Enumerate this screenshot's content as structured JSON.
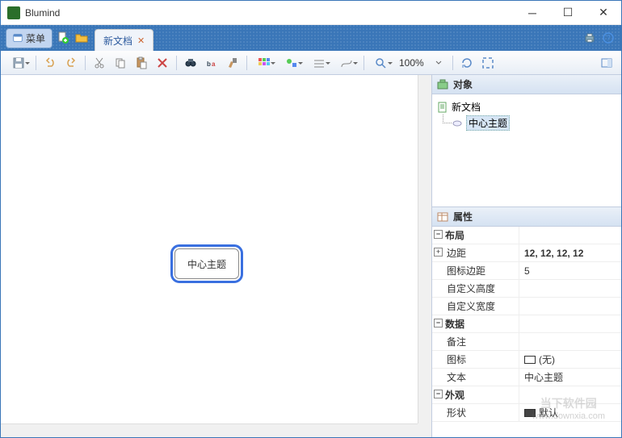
{
  "titlebar": {
    "title": "Blumind"
  },
  "menubar": {
    "menu_label": "菜单",
    "tab_label": "新文档"
  },
  "toolbar": {
    "zoom": "100%"
  },
  "canvas": {
    "central_topic": "中心主题"
  },
  "panels": {
    "objects": {
      "title": "对象",
      "root_label": "新文档",
      "child_label": "中心主题"
    },
    "properties": {
      "title": "属性",
      "groups": {
        "layout": {
          "label": "布局"
        },
        "data": {
          "label": "数据"
        },
        "appearance": {
          "label": "外观"
        }
      },
      "rows": {
        "margin": {
          "label": "边距",
          "value": "12, 12, 12, 12"
        },
        "icon_margin": {
          "label": "图标边距",
          "value": "5"
        },
        "custom_height": {
          "label": "自定义高度",
          "value": ""
        },
        "custom_width": {
          "label": "自定义宽度",
          "value": ""
        },
        "remark": {
          "label": "备注",
          "value": ""
        },
        "icon": {
          "label": "图标",
          "value": "(无)"
        },
        "text": {
          "label": "文本",
          "value": "中心主题"
        },
        "shape": {
          "label": "形状",
          "value": "默认"
        }
      }
    }
  },
  "watermark": {
    "line1": "当下软件园",
    "line2": "www.downxia.com"
  }
}
